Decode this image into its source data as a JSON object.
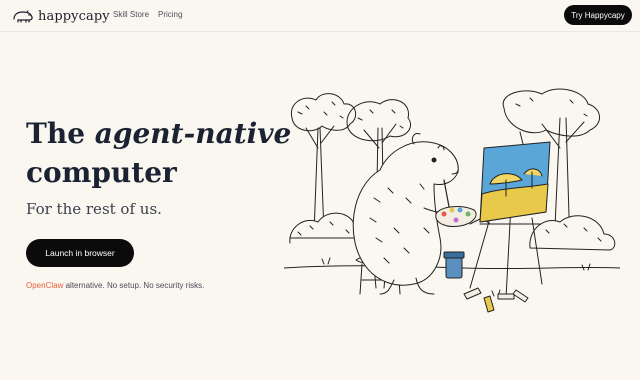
{
  "nav": {
    "brand": "happycapy",
    "brand_icon": "capybara-logo-icon",
    "links": [
      "Skill Store",
      "Pricing"
    ],
    "cta": "Try Happycapy"
  },
  "hero": {
    "title_prefix": "The",
    "title_emphasis": "agent-native",
    "title_line2": "computer",
    "subtitle": "For the rest of us.",
    "button": "Launch in browser",
    "tagline_accent": "OpenClaw",
    "tagline_rest": "alternative. No setup. No security risks."
  },
  "illustration": {
    "subject": "capybara-painting-at-easel",
    "icon": "capybara-painter-illustration"
  },
  "colors": {
    "background": "#faf7f1",
    "text": "#1b2333",
    "button": "#0b0b0c",
    "accent": "#e8613c",
    "canvas_sky": "#5aa6d6",
    "canvas_field": "#e8c94a"
  }
}
